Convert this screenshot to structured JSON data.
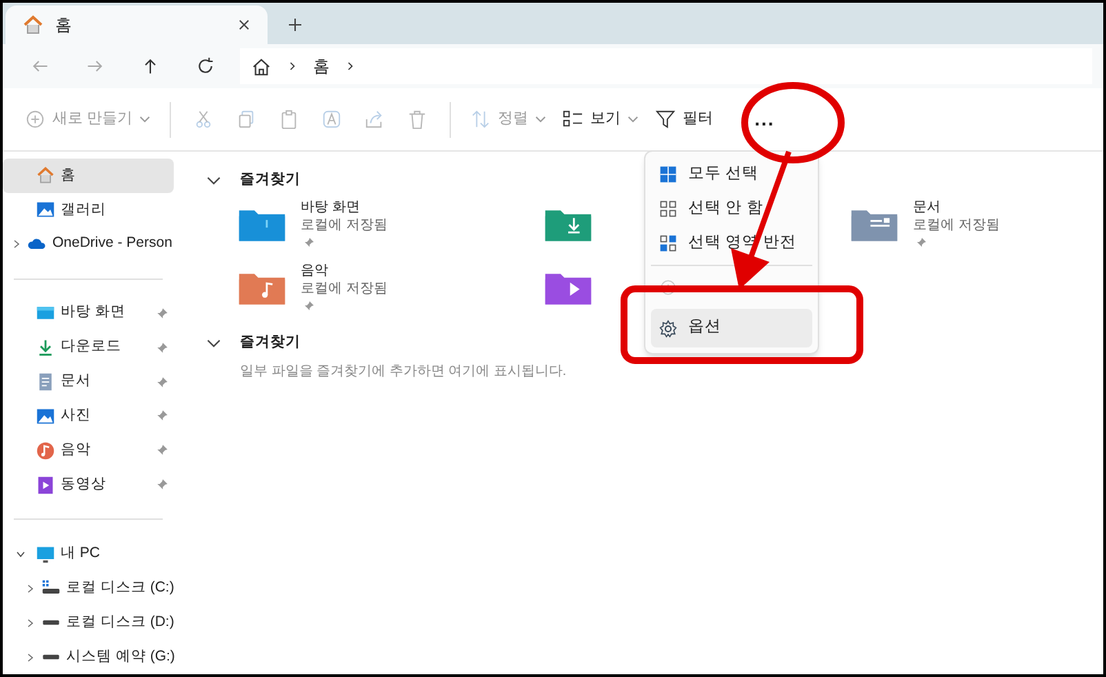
{
  "tabs": [
    {
      "title": "홈",
      "selected": true
    }
  ],
  "address": {
    "crumbs": [
      "홈"
    ]
  },
  "toolbar": [
    {
      "kind": "new",
      "label": "새로 만들기",
      "disabled": true,
      "dropdown": true
    },
    {
      "kind": "cut",
      "disabled": true
    },
    {
      "kind": "copy",
      "disabled": true
    },
    {
      "kind": "paste",
      "disabled": true
    },
    {
      "kind": "rename",
      "disabled": true
    },
    {
      "kind": "share",
      "disabled": true
    },
    {
      "kind": "delete",
      "disabled": true
    },
    {
      "kind": "sort",
      "label": "정렬",
      "disabled": true,
      "dropdown": true
    },
    {
      "kind": "view",
      "label": "보기",
      "disabled": false,
      "dropdown": true
    },
    {
      "kind": "filter",
      "label": "필터",
      "disabled": false,
      "dropdown": false
    },
    {
      "kind": "more",
      "label": "...",
      "disabled": false,
      "dropdown": false
    }
  ],
  "sidebar": {
    "groups": [
      [
        {
          "kind": "home",
          "label": "홈",
          "selected": true
        },
        {
          "kind": "gallery",
          "label": "갤러리",
          "selected": false
        },
        {
          "kind": "cloud",
          "label": "OneDrive - Person",
          "selected": false,
          "expandable": true
        }
      ],
      [
        {
          "kind": "desktop",
          "label": "바탕 화면",
          "selected": false,
          "pinned": true
        },
        {
          "kind": "download",
          "label": "다운로드",
          "selected": false,
          "pinned": true
        },
        {
          "kind": "docs",
          "label": "문서",
          "selected": false,
          "pinned": true
        },
        {
          "kind": "photo",
          "label": "사진",
          "selected": false,
          "pinned": true
        },
        {
          "kind": "music",
          "label": "음악",
          "selected": false,
          "pinned": true
        },
        {
          "kind": "video",
          "label": "동영상",
          "selected": false,
          "pinned": true
        }
      ],
      [
        {
          "kind": "pc",
          "label": "내 PC",
          "selected": false,
          "expanded": true,
          "children": [
            {
              "kind": "sysdisk",
              "label": "로컬 디스크 (C:)",
              "selected": false,
              "expandable": true
            },
            {
              "kind": "disk",
              "label": "로컬 디스크 (D:)",
              "selected": false,
              "expandable": true
            },
            {
              "kind": "disk",
              "label": "시스템 예약 (G:)",
              "selected": false,
              "expandable": true
            }
          ]
        }
      ]
    ]
  },
  "sections": [
    {
      "title": "즐겨찾기",
      "expanded": true,
      "tiles": [
        {
          "kind": "desktop",
          "name": "바탕 화면",
          "detail": "로컬에 저장됨",
          "pinned": true
        },
        {
          "kind": "download"
        },
        {
          "kind": "docs",
          "name": "문서",
          "detail": "로컬에 저장됨",
          "pinned": true
        },
        {
          "kind": "music",
          "name": "음악",
          "detail": "로컬에 저장됨",
          "pinned": true
        },
        {
          "kind": "video"
        }
      ]
    },
    {
      "title": "즐겨찾기",
      "expanded": true,
      "message": "일부 파일을 즐겨찾기에 추가하면 여기에 표시됩니다."
    }
  ],
  "menu": {
    "items": [
      {
        "kind": "selectall",
        "label": "모두 선택",
        "disabled": false,
        "highlighted": false
      },
      {
        "kind": "selectnone",
        "label": "선택 안 함",
        "disabled": false,
        "highlighted": false
      },
      {
        "kind": "invert",
        "label": "선택 영역 반전",
        "disabled": false,
        "highlighted": false
      },
      {
        "kind": "separator"
      },
      {
        "kind": "properties",
        "disabled": true,
        "highlighted": false
      },
      {
        "kind": "options",
        "label": "옵션",
        "disabled": false,
        "highlighted": true
      }
    ]
  }
}
